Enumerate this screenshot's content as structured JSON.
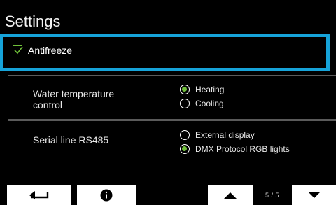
{
  "header": {
    "title": "Settings"
  },
  "antifreeze": {
    "label": "Antifreeze",
    "checked": true
  },
  "water_temperature": {
    "label": "Water temperature control",
    "options": [
      {
        "label": "Heating",
        "selected": true
      },
      {
        "label": "Cooling",
        "selected": false
      }
    ]
  },
  "serial_line": {
    "label": "Serial line RS485",
    "options": [
      {
        "label": "External display",
        "selected": false
      },
      {
        "label": "DMX Protocol RGB lights",
        "selected": true
      }
    ]
  },
  "footer": {
    "back_icon": "back-return-icon",
    "info_icon": "info-icon",
    "up_icon": "arrow-up-icon",
    "down_icon": "arrow-down-icon",
    "page_indicator": "5 / 5"
  },
  "colors": {
    "focus_border": "#16a3d9",
    "accent_green": "#6fbf3a",
    "background": "#000000"
  }
}
